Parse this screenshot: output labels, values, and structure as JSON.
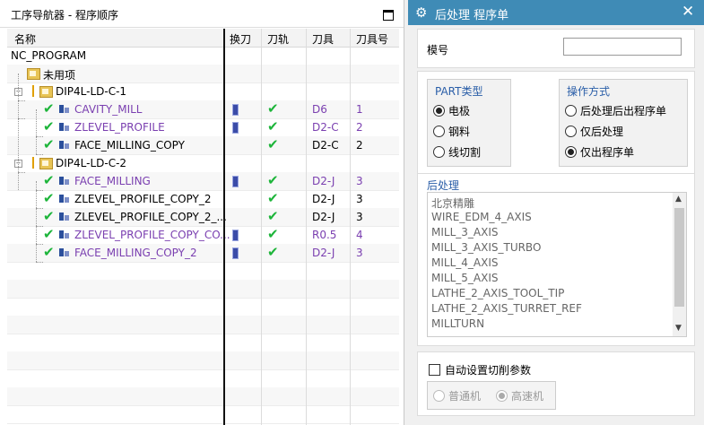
{
  "navigator": {
    "title": "工序导航器 - 程序顺序",
    "columns": [
      "名称",
      "换刀",
      "刀轨",
      "刀具",
      "刀具号"
    ],
    "root": "NC_PROGRAM",
    "rows": [
      {
        "name": "未用项",
        "level": 1,
        "kind": "folder",
        "tool": "",
        "toolno": "",
        "change": false,
        "path": false,
        "purple": false
      },
      {
        "name": "DIP4L-LD-C-1",
        "level": 1,
        "kind": "group",
        "tool": "",
        "toolno": "",
        "change": false,
        "path": false,
        "purple": false
      },
      {
        "name": "CAVITY_MILL",
        "level": 2,
        "kind": "op",
        "tool": "D6",
        "toolno": "1",
        "change": true,
        "path": true,
        "purple": true
      },
      {
        "name": "ZLEVEL_PROFILE",
        "level": 2,
        "kind": "op",
        "tool": "D2-C",
        "toolno": "2",
        "change": true,
        "path": true,
        "purple": true
      },
      {
        "name": "FACE_MILLING_COPY",
        "level": 2,
        "kind": "op",
        "tool": "D2-C",
        "toolno": "2",
        "change": false,
        "path": true,
        "purple": false
      },
      {
        "name": "DIP4L-LD-C-2",
        "level": 1,
        "kind": "group",
        "tool": "",
        "toolno": "",
        "change": false,
        "path": false,
        "purple": false
      },
      {
        "name": "FACE_MILLING",
        "level": 2,
        "kind": "op",
        "tool": "D2-J",
        "toolno": "3",
        "change": true,
        "path": true,
        "purple": true
      },
      {
        "name": "ZLEVEL_PROFILE_COPY_2",
        "level": 2,
        "kind": "op",
        "tool": "D2-J",
        "toolno": "3",
        "change": false,
        "path": true,
        "purple": false
      },
      {
        "name": "ZLEVEL_PROFILE_COPY_2_...",
        "level": 2,
        "kind": "op",
        "tool": "D2-J",
        "toolno": "3",
        "change": false,
        "path": true,
        "purple": false
      },
      {
        "name": "ZLEVEL_PROFILE_COPY_CO...",
        "level": 2,
        "kind": "op",
        "tool": "R0.5",
        "toolno": "4",
        "change": true,
        "path": true,
        "purple": true
      },
      {
        "name": "FACE_MILLING_COPY_2",
        "level": 2,
        "kind": "op",
        "tool": "D2-J",
        "toolno": "3",
        "change": true,
        "path": true,
        "purple": true
      }
    ]
  },
  "dialog": {
    "title": "后处理 程序单",
    "model_label": "模号",
    "model_value": "",
    "part_type": {
      "title": "PART类型",
      "options": [
        "电极",
        "钢料",
        "线切割"
      ],
      "selected": 0
    },
    "operation": {
      "title": "操作方式",
      "options": [
        "后处理后出程序单",
        "仅后处理",
        "仅出程序单"
      ],
      "selected": 2
    },
    "post": {
      "title": "后处理",
      "items": [
        "北京精雕",
        "WIRE_EDM_4_AXIS",
        "MILL_3_AXIS",
        "MILL_3_AXIS_TURBO",
        "MILL_4_AXIS",
        "MILL_5_AXIS",
        "LATHE_2_AXIS_TOOL_TIP",
        "LATHE_2_AXIS_TURRET_REF",
        "MILLTURN"
      ]
    },
    "auto_param_label": "自动设置切削参数",
    "auto_param_checked": false,
    "machine": {
      "options": [
        "普通机",
        "高速机"
      ],
      "selected": 1
    }
  },
  "colors": {
    "title_bar": "#3f8bb6",
    "purple_text": "#7a3fb0",
    "check_green": "#1db53a",
    "group_title": "#2a5ea8"
  }
}
